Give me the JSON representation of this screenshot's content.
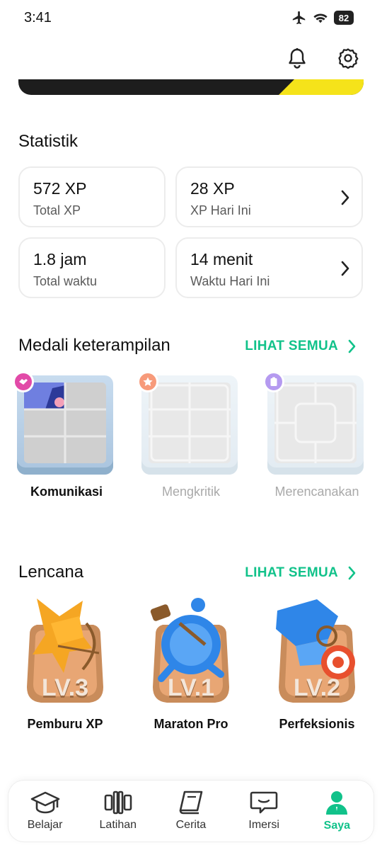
{
  "status_bar": {
    "time": "3:41",
    "battery": "82"
  },
  "header": {
    "bell_icon": "bell-icon",
    "settings_icon": "gear-icon"
  },
  "stats": {
    "title": "Statistik",
    "cards": [
      {
        "value": "572 XP",
        "label": "Total XP",
        "has_chevron": false
      },
      {
        "value": "28 XP",
        "label": "XP Hari Ini",
        "has_chevron": true
      },
      {
        "value": "1.8 jam",
        "label": "Total waktu",
        "has_chevron": false
      },
      {
        "value": "14 menit",
        "label": "Waktu Hari Ini",
        "has_chevron": true
      }
    ]
  },
  "skills": {
    "title": "Medali keterampilan",
    "see_all": "LIHAT SEMUA",
    "items": [
      {
        "label": "Komunikasi",
        "unlocked": true,
        "badge_color": "#e24aa8"
      },
      {
        "label": "Mengkritik",
        "unlocked": false,
        "badge_color": "#f79a7a"
      },
      {
        "label": "Merencanakan",
        "unlocked": false,
        "badge_color": "#b59af0"
      }
    ]
  },
  "badges": {
    "title": "Lencana",
    "see_all": "LIHAT SEMUA",
    "items": [
      {
        "name": "Pemburu XP",
        "level": "LV.3",
        "figure_color": "#f5a623"
      },
      {
        "name": "Maraton Pro",
        "level": "LV.1",
        "figure_color": "#2f86e8"
      },
      {
        "name": "Perfeksionis",
        "level": "LV.2",
        "figure_color": "#2f86e8"
      }
    ]
  },
  "nav": {
    "items": [
      {
        "label": "Belajar",
        "icon": "graduation-cap-icon",
        "active": false
      },
      {
        "label": "Latihan",
        "icon": "dumbbell-icon",
        "active": false
      },
      {
        "label": "Cerita",
        "icon": "book-icon",
        "active": false
      },
      {
        "label": "Imersi",
        "icon": "chat-icon",
        "active": false
      },
      {
        "label": "Saya",
        "icon": "person-icon",
        "active": true
      }
    ]
  },
  "colors": {
    "accent": "#11c28a",
    "banner_dark": "#1d1d1d",
    "banner_yellow": "#f5e31a"
  }
}
